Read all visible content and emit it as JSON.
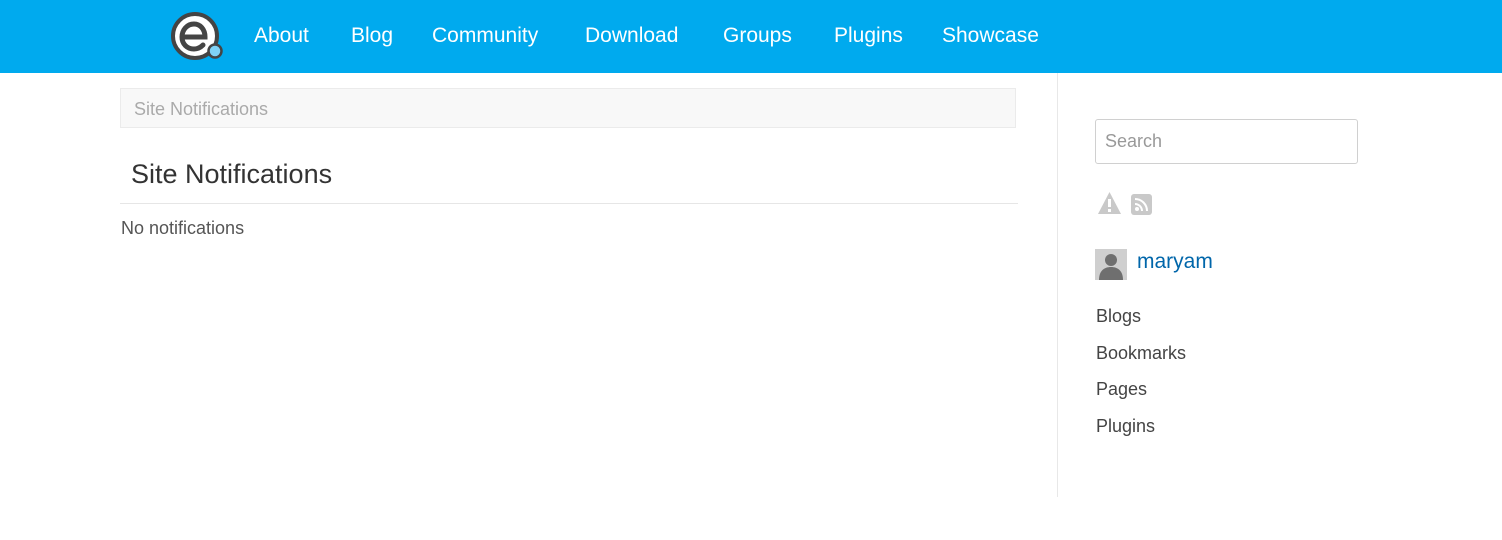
{
  "header": {
    "logo_icon": "elgg-logo-icon",
    "nav": [
      {
        "label": "About"
      },
      {
        "label": "Blog"
      },
      {
        "label": "Community"
      },
      {
        "label": "Download"
      },
      {
        "label": "Groups"
      },
      {
        "label": "Plugins"
      },
      {
        "label": "Showcase"
      }
    ],
    "bg_color": "#00aaee"
  },
  "breadcrumb": {
    "label": "Site Notifications"
  },
  "main": {
    "title": "Site Notifications",
    "empty_text": "No notifications"
  },
  "sidebar": {
    "search": {
      "placeholder": "Search",
      "value": ""
    },
    "icons": [
      "report-warning-icon",
      "rss-icon"
    ],
    "user": {
      "name": "maryam",
      "avatar_icon": "user-avatar-icon"
    },
    "links": [
      {
        "label": "Blogs"
      },
      {
        "label": "Bookmarks"
      },
      {
        "label": "Pages"
      },
      {
        "label": "Plugins"
      }
    ]
  }
}
